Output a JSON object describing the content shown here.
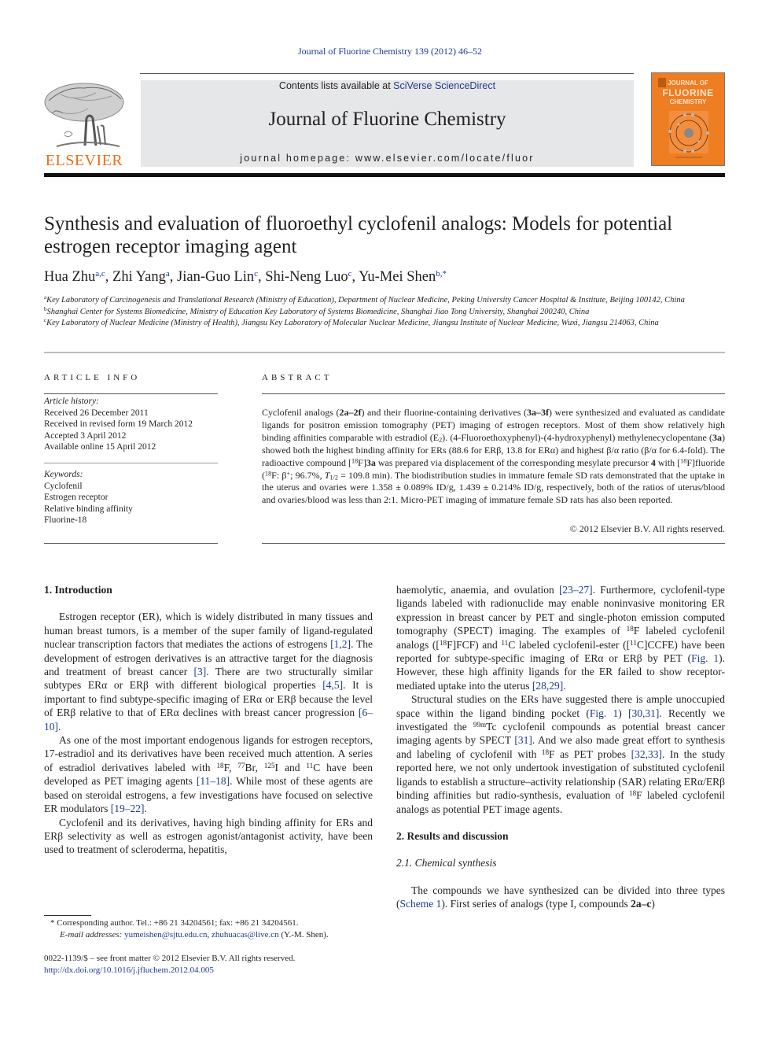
{
  "header": {
    "running_head": "Journal of Fluorine Chemistry 139 (2012) 46–52",
    "contents_prefix": "Contents lists available at ",
    "contents_link": "SciVerse ScienceDirect",
    "journal_name": "Journal of Fluorine Chemistry",
    "homepage_prefix": "journal homepage: ",
    "homepage_url": "www.elsevier.com/locate/fluor",
    "publisher_logo_text": "ELSEVIER",
    "cover": {
      "line1": "JOURNAL OF",
      "line2": "FLUORINE",
      "line3": "CHEMISTRY"
    },
    "colors": {
      "elsevier_orange": "#e9711c",
      "cover_orange": "#ef7d22",
      "masthead_gray": "#e6e7e8",
      "link_blue": "#1f3a8f"
    }
  },
  "article": {
    "title": "Synthesis and evaluation of fluoroethyl cyclofenil analogs: Models for potential estrogen receptor imaging agent",
    "authors": [
      {
        "name": "Hua Zhu",
        "affil": "a,c"
      },
      {
        "name": "Zhi Yang",
        "affil": "a"
      },
      {
        "name": "Jian-Guo Lin",
        "affil": "c"
      },
      {
        "name": "Shi-Neng Luo",
        "affil": "c"
      },
      {
        "name": "Yu-Mei Shen",
        "affil": "b,*"
      }
    ],
    "affiliations": [
      {
        "mark": "a",
        "text": "Key Laboratory of Carcinogenesis and Translational Research (Ministry of Education), Department of Nuclear Medicine, Peking University Cancer Hospital & Institute, Beijing 100142, China"
      },
      {
        "mark": "b",
        "text": "Shanghai Center for Systems Biomedicine, Ministry of Education Key Laboratory of Systems Biomedicine, Shanghai Jiao Tong University, Shanghai 200240, China"
      },
      {
        "mark": "c",
        "text": "Key Laboratory of Nuclear Medicine (Ministry of Health), Jiangsu Key Laboratory of Molecular Nuclear Medicine, Jiangsu Institute of Nuclear Medicine, Wuxi, Jiangsu 214063, China"
      }
    ]
  },
  "article_info": {
    "heading": "ARTICLE INFO",
    "history_label": "Article history:",
    "history": [
      "Received 26 December 2011",
      "Received in revised form 19 March 2012",
      "Accepted 3 April 2012",
      "Available online 15 April 2012"
    ],
    "keywords_label": "Keywords:",
    "keywords": [
      "Cyclofenil",
      "Estrogen receptor",
      "Relative binding affinity",
      "Fluorine-18"
    ]
  },
  "abstract": {
    "heading": "ABSTRACT",
    "copyright": "© 2012 Elsevier B.V. All rights reserved."
  },
  "body": {
    "sec1_heading": "1.  Introduction",
    "sec2_heading": "2.  Results and discussion",
    "sec21_heading": "2.1.  Chemical synthesis"
  },
  "footnote": {
    "corresponding": "* Corresponding author. Tel.: +86 21 34204561; fax: +86 21 34204561.",
    "email_label": "E-mail addresses:",
    "email1": "yumeishen@sjtu.edu.cn",
    "email2": "zhuhuacas@live.cn",
    "email_suffix": " (Y.-M. Shen).",
    "issn": "0022-1139/$ – see front matter © 2012 Elsevier B.V. All rights reserved.",
    "doi": "http://dx.doi.org/10.1016/j.jfluchem.2012.04.005"
  }
}
